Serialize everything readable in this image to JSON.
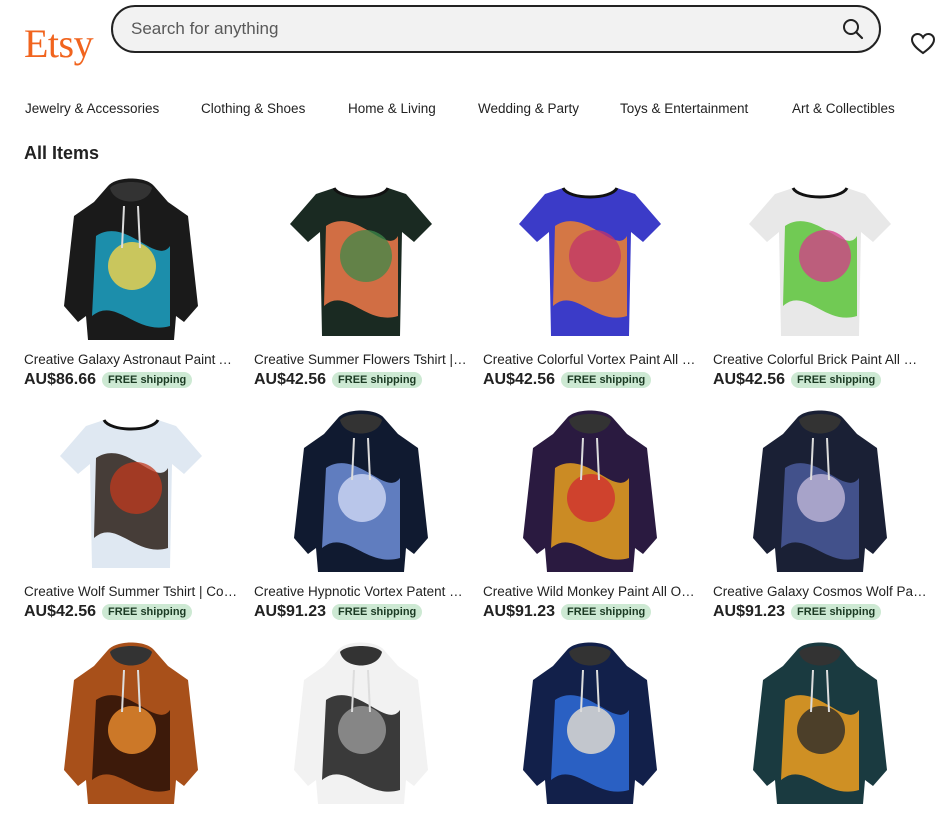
{
  "header": {
    "logo": "Etsy",
    "search_placeholder": "Search for anything"
  },
  "nav": [
    "Jewelry & Accessories",
    "Clothing & Shoes",
    "Home & Living",
    "Wedding & Party",
    "Toys & Entertainment",
    "Art & Collectibles"
  ],
  "section_title": "All Items",
  "products": [
    {
      "name": "Creative Galaxy Astronaut Paint All Over Hoodie",
      "price": "AU$86.66",
      "badge": "FREE shipping",
      "kind": "hoodie",
      "colors": [
        "#1a1a1a",
        "#1da3c6",
        "#f5d54a"
      ]
    },
    {
      "name": "Creative Summer Flowers Tshirt | Tropical Print",
      "price": "AU$42.56",
      "badge": "FREE shipping",
      "kind": "tee",
      "colors": [
        "#1a2a22",
        "#f27a4a",
        "#3d8a4a"
      ]
    },
    {
      "name": "Creative Colorful Vortex Paint All Over Tshirt",
      "price": "AU$42.56",
      "badge": "FREE shipping",
      "kind": "tee",
      "colors": [
        "#3b3bc8",
        "#f0822e",
        "#c2346a"
      ]
    },
    {
      "name": "Creative Colorful Brick Paint All Over Tshirt",
      "price": "AU$42.56",
      "badge": "FREE shipping",
      "kind": "tee",
      "colors": [
        "#e8e8e8",
        "#5cc43a",
        "#d63a8a"
      ]
    },
    {
      "name": "Creative Wolf Summer Tshirt | Cool Print",
      "price": "AU$42.56",
      "badge": "FREE shipping",
      "kind": "tee",
      "colors": [
        "#dfe8f2",
        "#2c1e18",
        "#c23a1e"
      ]
    },
    {
      "name": "Creative Hypnotic Vortex Patent Hoodie",
      "price": "AU$91.23",
      "badge": "FREE shipping",
      "kind": "hoodie",
      "colors": [
        "#101a30",
        "#6f8fd8",
        "#d0d8f5"
      ]
    },
    {
      "name": "Creative Wild Monkey Paint All Over Hoodie",
      "price": "AU$91.23",
      "badge": "FREE shipping",
      "kind": "hoodie",
      "colors": [
        "#2a1a40",
        "#e8a020",
        "#d03030"
      ]
    },
    {
      "name": "Creative Galaxy Cosmos Wolf Paint Hoodie",
      "price": "AU$91.23",
      "badge": "FREE shipping",
      "kind": "hoodie",
      "colors": [
        "#1a2035",
        "#4a5a9a",
        "#c0b8d8"
      ]
    },
    {
      "name": "",
      "price": "",
      "badge": "",
      "kind": "hoodie",
      "colors": [
        "#a8501a",
        "#2a1008",
        "#f09030"
      ]
    },
    {
      "name": "",
      "price": "",
      "badge": "",
      "kind": "hoodie",
      "colors": [
        "#f2f2f2",
        "#1a1a1a",
        "#9a9a9a"
      ]
    },
    {
      "name": "",
      "price": "",
      "badge": "",
      "kind": "hoodie",
      "colors": [
        "#12204a",
        "#2f6cd8",
        "#e8e0d0"
      ]
    },
    {
      "name": "",
      "price": "",
      "badge": "",
      "kind": "hoodie",
      "colors": [
        "#1a3a40",
        "#f0a020",
        "#2a2a2a"
      ]
    }
  ],
  "icons": {
    "search": "search-icon",
    "favorites": "heart-icon"
  },
  "colors": {
    "brand": "#F1641E",
    "badge_bg": "#cde9d3"
  }
}
